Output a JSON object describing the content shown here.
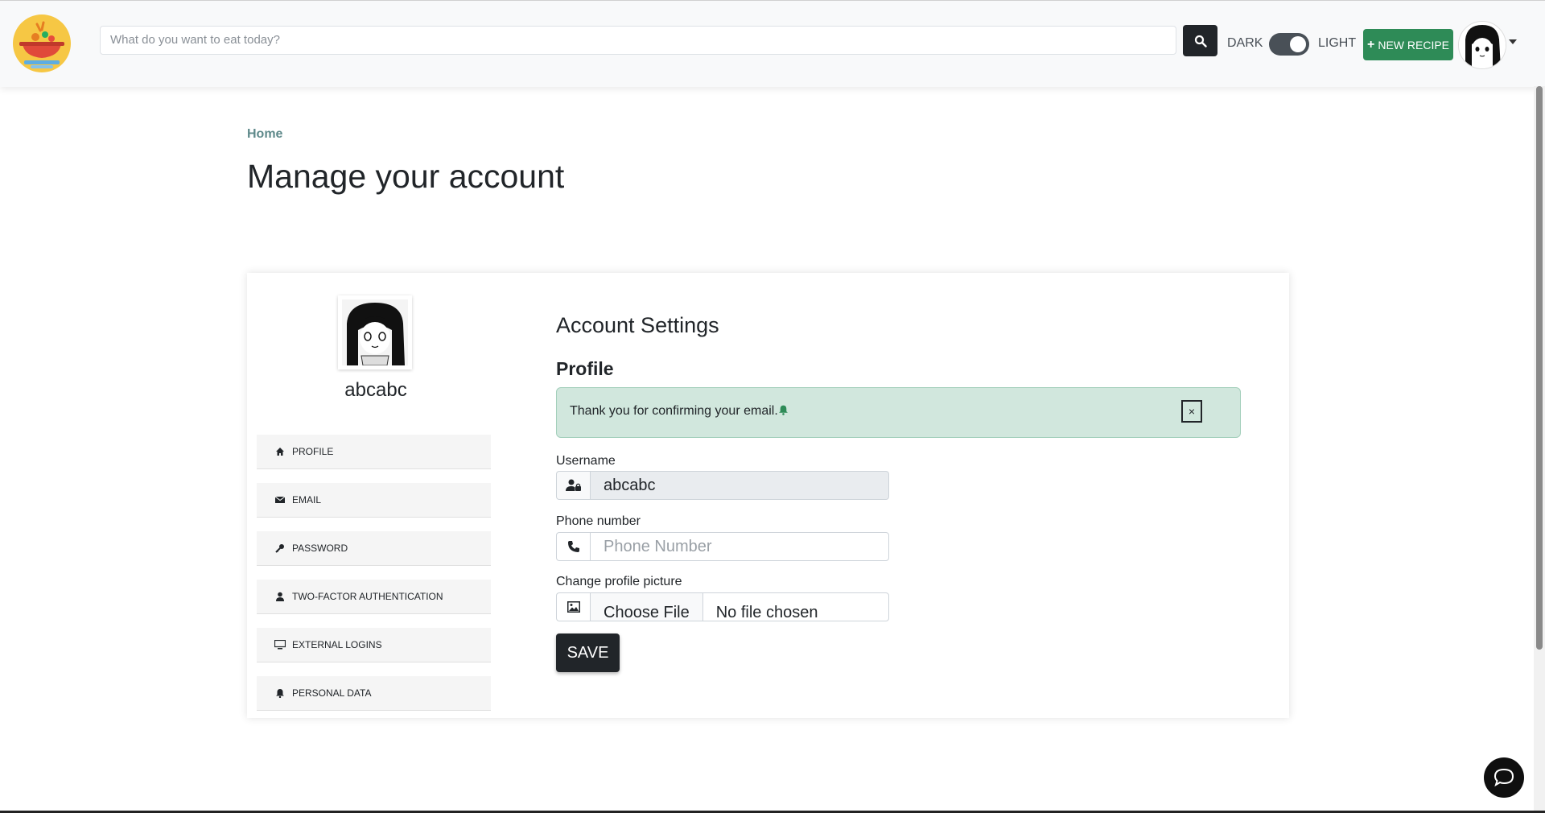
{
  "header": {
    "search_placeholder": "What do you want to eat today?",
    "dark_label": "DARK",
    "light_label": "LIGHT",
    "new_recipe_label": "NEW RECIPE",
    "new_recipe_icon": "+"
  },
  "breadcrumb": {
    "home": "Home"
  },
  "page_title": "Manage your account",
  "sidebar": {
    "username": "abcabc",
    "items": [
      {
        "label": "PROFILE",
        "icon": "home-icon"
      },
      {
        "label": "EMAIL",
        "icon": "envelope-icon"
      },
      {
        "label": "PASSWORD",
        "icon": "key-icon"
      },
      {
        "label": "TWO-FACTOR AUTHENTICATION",
        "icon": "user-icon"
      },
      {
        "label": "EXTERNAL LOGINS",
        "icon": "monitor-icon"
      },
      {
        "label": "PERSONAL DATA",
        "icon": "bell-icon"
      }
    ]
  },
  "main": {
    "heading": "Account Settings",
    "subheading": "Profile",
    "alert_message": "Thank you for confirming your email.",
    "alert_close": "×",
    "username_label": "Username",
    "username_value": "abcabc",
    "phone_label": "Phone number",
    "phone_placeholder": "Phone Number",
    "picture_label": "Change profile picture",
    "file_button": "Choose File",
    "file_status": "No file chosen",
    "save_label": "SAVE"
  },
  "colors": {
    "accent_green": "#2e8b57",
    "alert_bg": "#d1e7dd",
    "dark": "#212529"
  }
}
